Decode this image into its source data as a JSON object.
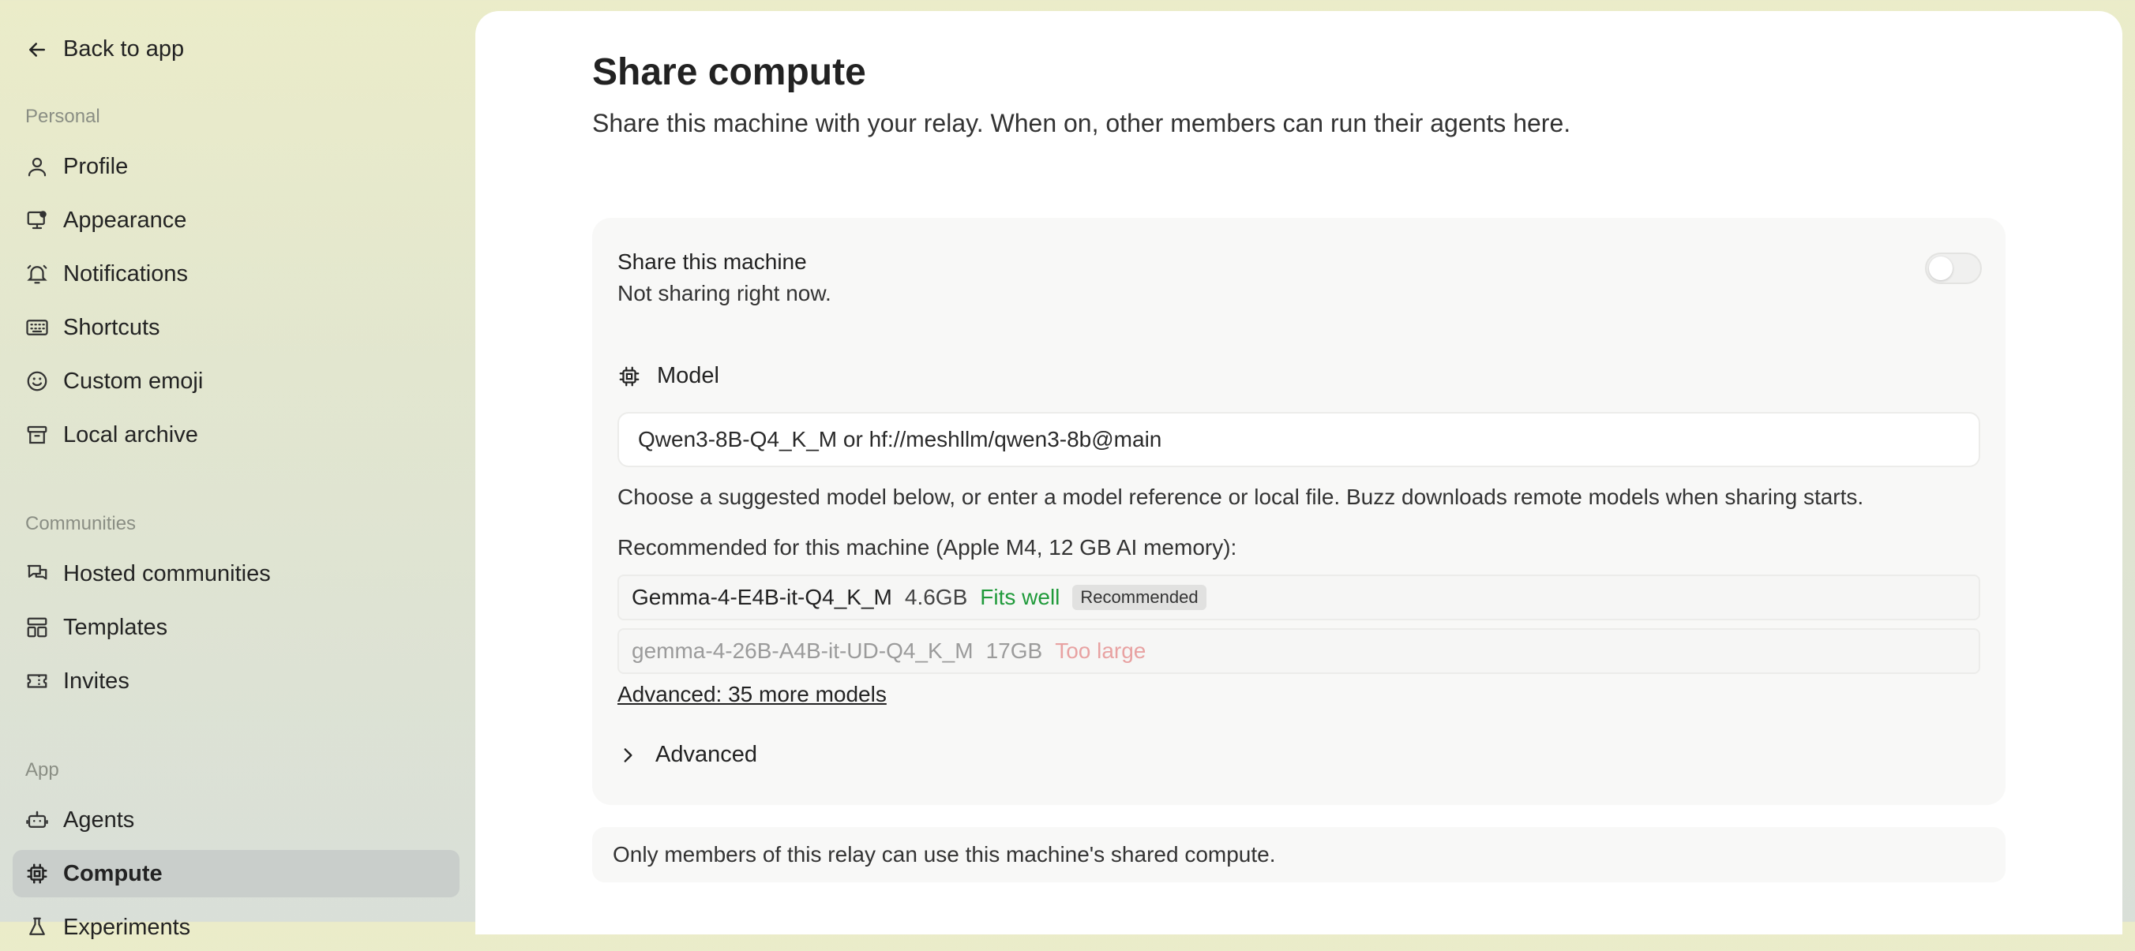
{
  "sidebar": {
    "back_label": "Back to app",
    "sections": {
      "personal": "Personal",
      "communities": "Communities",
      "app": "App"
    },
    "items": [
      {
        "label": "Profile",
        "icon": "user-icon"
      },
      {
        "label": "Appearance",
        "icon": "monitor-icon"
      },
      {
        "label": "Notifications",
        "icon": "bell-icon"
      },
      {
        "label": "Shortcuts",
        "icon": "keyboard-icon"
      },
      {
        "label": "Custom emoji",
        "icon": "smiley-icon"
      },
      {
        "label": "Local archive",
        "icon": "archive-icon"
      },
      {
        "label": "Hosted communities",
        "icon": "chat-bubbles-icon"
      },
      {
        "label": "Templates",
        "icon": "layout-icon"
      },
      {
        "label": "Invites",
        "icon": "ticket-icon"
      },
      {
        "label": "Agents",
        "icon": "robot-icon"
      },
      {
        "label": "Compute",
        "icon": "cpu-chip-icon",
        "active": true
      },
      {
        "label": "Experiments",
        "icon": "flask-icon"
      }
    ]
  },
  "page": {
    "title": "Share compute",
    "subtitle": "Share this machine with your relay. When on, other members can run their agents here."
  },
  "share": {
    "title": "Share this machine",
    "status": "Not sharing right now.",
    "enabled": false
  },
  "model": {
    "heading": "Model",
    "input_value": "",
    "input_placeholder": "Qwen3-8B-Q4_K_M or hf://meshllm/qwen3-8b@main",
    "help_text": "Choose a suggested model below, or enter a model reference or local file. Buzz downloads remote models when sharing starts.",
    "recommended_heading": "Recommended for this machine (Apple M4, 12 GB AI memory):",
    "options": [
      {
        "name": "Gemma-4-E4B-it-Q4_K_M",
        "size": "4.6GB",
        "fit": "Fits well",
        "badge": "Recommended"
      },
      {
        "name": "gemma-4-26B-A4B-it-UD-Q4_K_M",
        "size": "17GB",
        "fit": "Too large"
      }
    ],
    "more_link": "Advanced: 35 more models",
    "advanced_label": "Advanced"
  },
  "footer_note": "Only members of this relay can use this machine's shared compute.",
  "colors": {
    "fit_good": "#1f9a3a",
    "fit_bad": "#e8a2a2",
    "active_nav_bg": "#c9cecb"
  }
}
